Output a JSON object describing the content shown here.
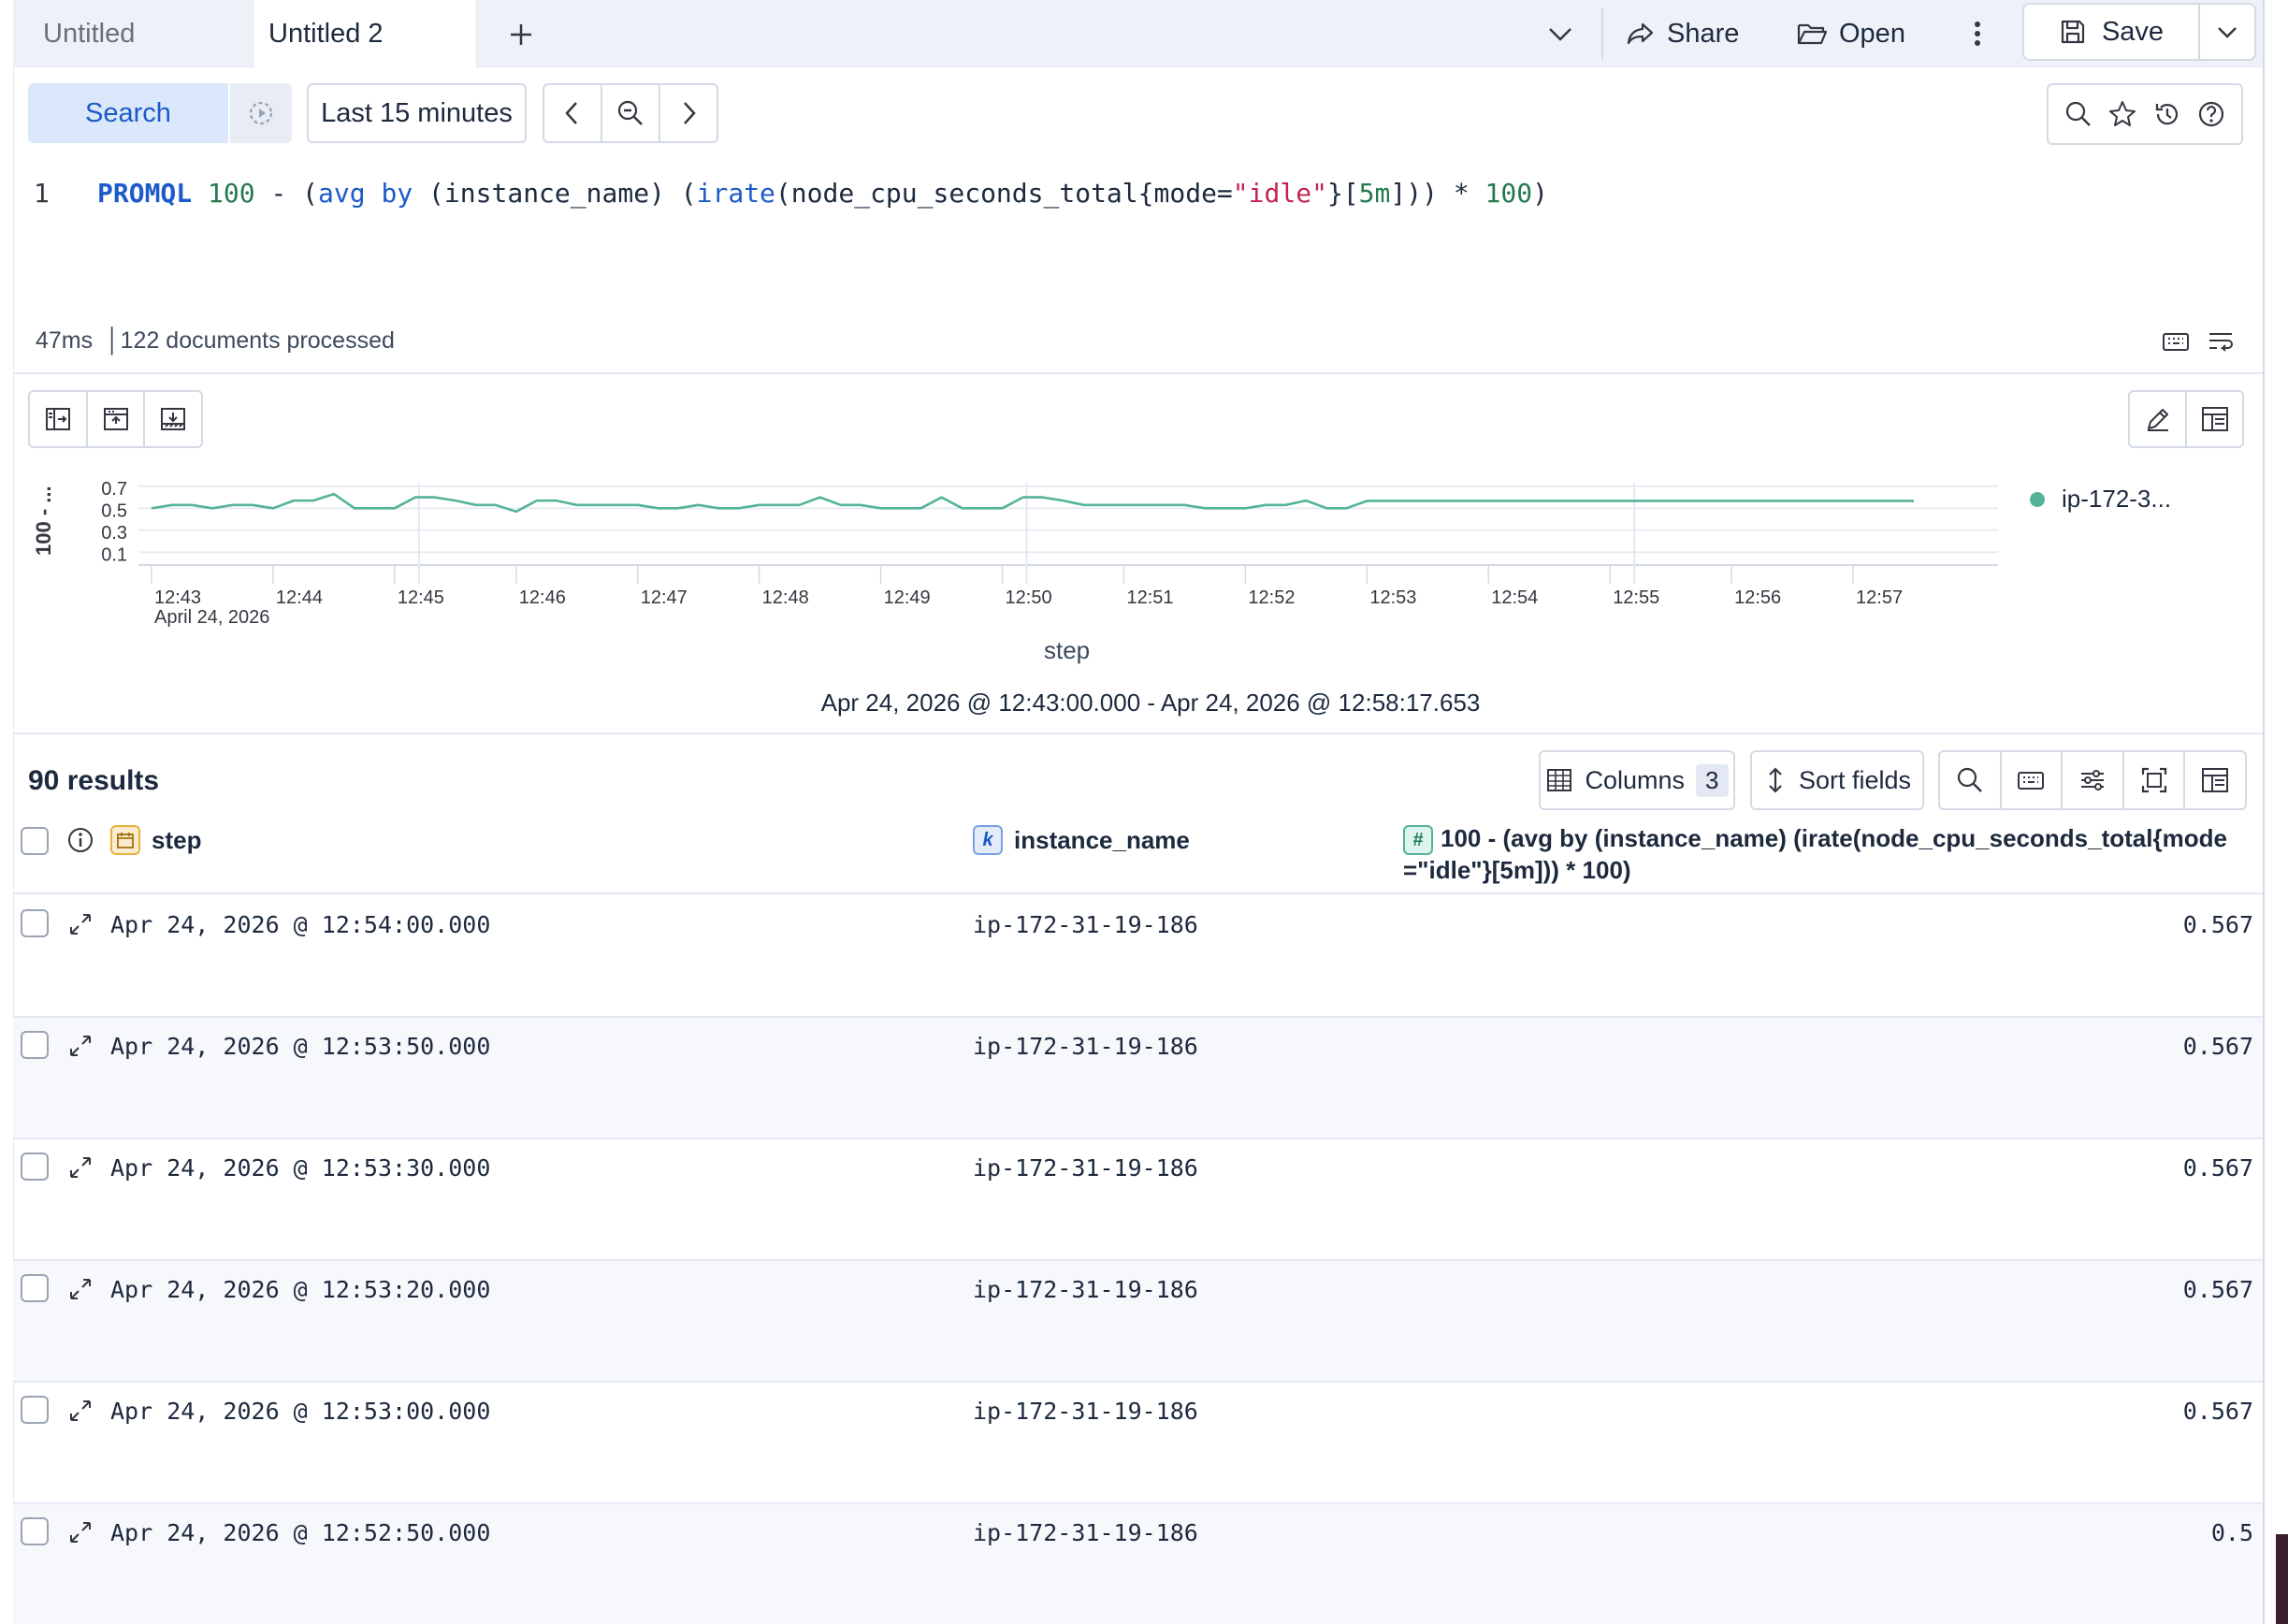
{
  "tabs": [
    {
      "label": "Untitled"
    },
    {
      "label": "Untitled 2"
    }
  ],
  "header": {
    "share_label": "Share",
    "open_label": "Open",
    "save_label": "Save"
  },
  "query_bar": {
    "search_label": "Search",
    "time_range_label": "Last 15 minutes",
    "line_number": "1",
    "query": {
      "keyword": "PROMQL",
      "t1": "100",
      "t2": " - (",
      "t3": "avg",
      "t4": " ",
      "t5": "by",
      "t6": " (instance_name) (",
      "t7": "irate",
      "t8": "(node_cpu_seconds_total{mode=",
      "t9": "\"idle\"",
      "t10": "}[",
      "t11": "5m",
      "t12": "])) * ",
      "t13": "100",
      "t14": ")"
    }
  },
  "stats": {
    "text": "47ms  │122 documents processed"
  },
  "chart": {
    "y_axis_label": "100 - ...",
    "x_axis_title": "step",
    "date_label": "April 24, 2026",
    "time_range": "Apr 24, 2026 @ 12:43:00.000 - Apr 24, 2026 @ 12:58:17.653",
    "legend_label": "ip-172-3...",
    "series_color": "#54b399"
  },
  "chart_data": {
    "type": "line",
    "xlabel": "step",
    "ylabel": "100 - ...",
    "ylim": [
      0,
      0.75
    ],
    "y_ticks": [
      "0.7",
      "0.5",
      "0.3",
      "0.1"
    ],
    "x_ticks": [
      "12:43",
      "12:44",
      "12:45",
      "12:46",
      "12:47",
      "12:48",
      "12:49",
      "12:50",
      "12:51",
      "12:52",
      "12:53",
      "12:54",
      "12:55",
      "12:56",
      "12:57"
    ],
    "grid": true,
    "legend": "right",
    "series": [
      {
        "name": "ip-172-3...",
        "color": "#54b399",
        "x_minutes_from_1243": [
          0,
          0.17,
          0.33,
          0.5,
          0.67,
          0.83,
          1,
          1.17,
          1.33,
          1.5,
          1.67,
          1.83,
          2,
          2.17,
          2.33,
          2.5,
          2.67,
          2.83,
          3,
          3.17,
          3.33,
          3.5,
          3.67,
          3.83,
          4,
          4.17,
          4.33,
          4.5,
          4.67,
          4.83,
          5,
          5.17,
          5.33,
          5.5,
          5.67,
          5.83,
          6,
          6.17,
          6.33,
          6.5,
          6.67,
          6.83,
          7,
          7.17,
          7.33,
          7.5,
          7.67,
          7.83,
          8,
          8.17,
          8.33,
          8.5,
          8.67,
          8.83,
          9,
          9.17,
          9.33,
          9.5,
          9.67,
          9.83,
          10,
          10.5,
          11,
          11.5,
          12,
          12.5,
          13,
          13.5,
          14,
          14.5
        ],
        "values": [
          0.5,
          0.53,
          0.53,
          0.5,
          0.53,
          0.53,
          0.5,
          0.57,
          0.57,
          0.63,
          0.5,
          0.5,
          0.5,
          0.6,
          0.6,
          0.57,
          0.53,
          0.53,
          0.47,
          0.57,
          0.57,
          0.53,
          0.53,
          0.53,
          0.53,
          0.5,
          0.5,
          0.53,
          0.5,
          0.5,
          0.53,
          0.53,
          0.53,
          0.6,
          0.53,
          0.53,
          0.5,
          0.5,
          0.5,
          0.6,
          0.5,
          0.5,
          0.5,
          0.6,
          0.6,
          0.57,
          0.53,
          0.53,
          0.53,
          0.53,
          0.53,
          0.53,
          0.5,
          0.5,
          0.5,
          0.53,
          0.53,
          0.57,
          0.5,
          0.5,
          0.567,
          0.567,
          0.567,
          0.567,
          0.567,
          0.567,
          0.567,
          0.567,
          0.567,
          0.567
        ]
      }
    ]
  },
  "results": {
    "count_label": "90 results",
    "columns_label": "Columns",
    "columns_count": "3",
    "sort_label": "Sort fields",
    "headers": {
      "step": "step",
      "instance": "instance_name",
      "value": "100 - (avg by (instance_name) (irate(node_cpu_seconds_total{mode=\"idle\"}[5m])) * 100)"
    },
    "badges": {
      "date": "",
      "keyword": "k",
      "number": "#"
    },
    "rows": [
      {
        "step": "Apr 24, 2026 @ 12:54:00.000",
        "instance": "ip-172-31-19-186",
        "value": "0.567"
      },
      {
        "step": "Apr 24, 2026 @ 12:53:50.000",
        "instance": "ip-172-31-19-186",
        "value": "0.567"
      },
      {
        "step": "Apr 24, 2026 @ 12:53:30.000",
        "instance": "ip-172-31-19-186",
        "value": "0.567"
      },
      {
        "step": "Apr 24, 2026 @ 12:53:20.000",
        "instance": "ip-172-31-19-186",
        "value": "0.567"
      },
      {
        "step": "Apr 24, 2026 @ 12:53:00.000",
        "instance": "ip-172-31-19-186",
        "value": "0.567"
      },
      {
        "step": "Apr 24, 2026 @ 12:52:50.000",
        "instance": "ip-172-31-19-186",
        "value": "0.5"
      }
    ]
  },
  "colors": {
    "accent": "#1c5bc9",
    "series": "#54b399",
    "border": "#d3dae6"
  }
}
